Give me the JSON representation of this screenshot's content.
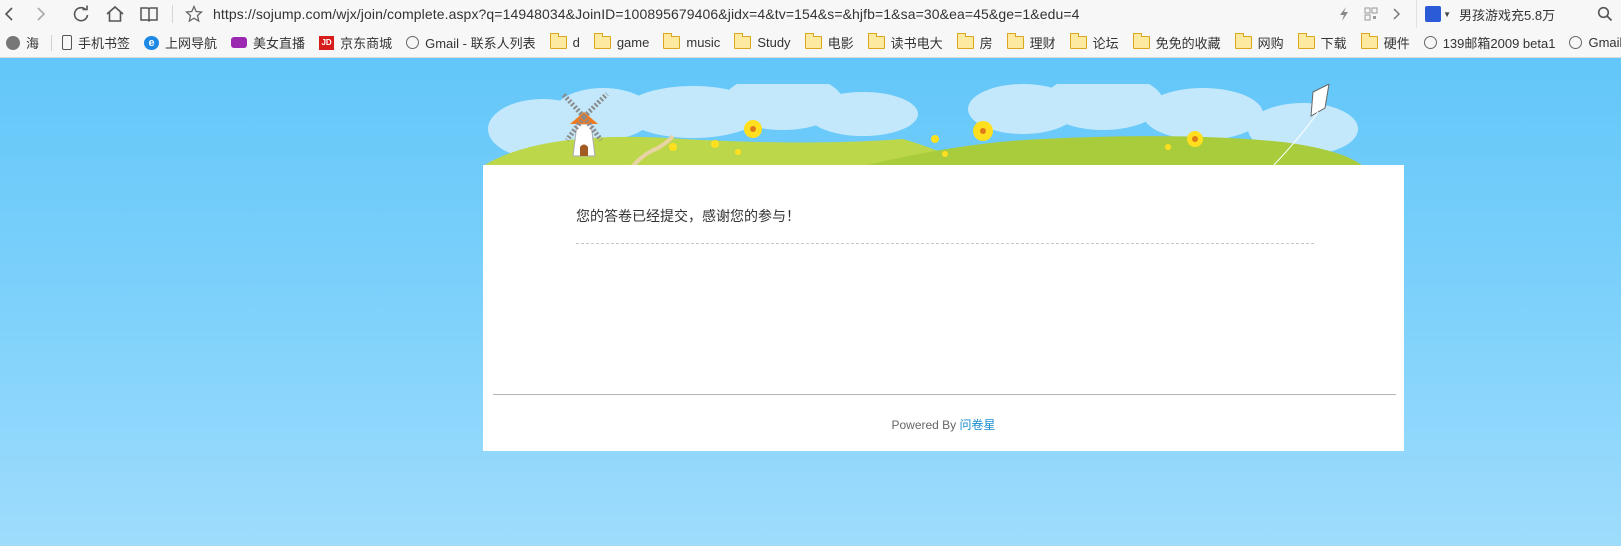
{
  "browser": {
    "url": "https://sojump.com/wjx/join/complete.aspx?q=14948034&JoinID=100895679406&jidx=4&tv=154&s=&hjfb=1&sa=30&ea=45&ge=1&edu=4",
    "search_query": "男孩游戏充5.8万",
    "icons": [
      "back-icon",
      "forward-icon",
      "reload-icon",
      "home-icon",
      "reader-icon",
      "star-icon",
      "lightning-icon",
      "qr-icon",
      "chevron-right-icon",
      "search-icon"
    ]
  },
  "bookmarks": [
    {
      "label": "海",
      "icon": "avatar"
    },
    {
      "label": "手机书签",
      "icon": "phone"
    },
    {
      "label": "上网导航",
      "icon": "ie"
    },
    {
      "label": "美女直播",
      "icon": "video"
    },
    {
      "label": "京东商城",
      "icon": "jd"
    },
    {
      "label": "Gmail - 联系人列表",
      "icon": "globe"
    },
    {
      "label": "d",
      "icon": "folder"
    },
    {
      "label": "game",
      "icon": "folder"
    },
    {
      "label": "music",
      "icon": "folder"
    },
    {
      "label": "Study",
      "icon": "folder"
    },
    {
      "label": "电影",
      "icon": "folder"
    },
    {
      "label": "读书电大",
      "icon": "folder"
    },
    {
      "label": "房",
      "icon": "folder"
    },
    {
      "label": "理财",
      "icon": "folder"
    },
    {
      "label": "论坛",
      "icon": "folder"
    },
    {
      "label": "免免的收藏",
      "icon": "folder"
    },
    {
      "label": "网购",
      "icon": "folder"
    },
    {
      "label": "下载",
      "icon": "folder"
    },
    {
      "label": "硬件",
      "icon": "folder"
    },
    {
      "label": "139邮箱2009 beta1",
      "icon": "globe"
    },
    {
      "label": "Gmail -",
      "icon": "globe"
    }
  ],
  "page": {
    "message": "您的答卷已经提交，感谢您的参与！",
    "powered_prefix": "Powered By",
    "powered_link": "问卷星"
  },
  "colors": {
    "sky_top": "#5cc4f8",
    "sky_bottom": "#9fdcfc",
    "link": "#1a8ccf"
  }
}
